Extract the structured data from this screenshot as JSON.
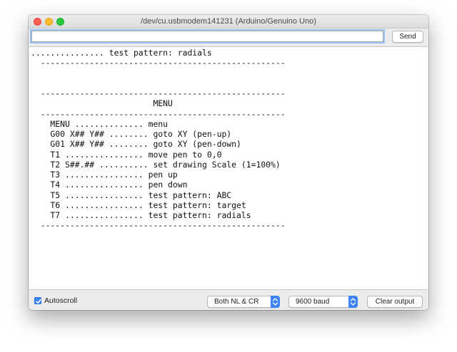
{
  "window": {
    "title": "/dev/cu.usbmodem141231 (Arduino/Genuino Uno)"
  },
  "toolbar": {
    "input_value": "",
    "send_label": "Send"
  },
  "output": {
    "lines": [
      "............... test pattern: radials",
      "  --------------------------------------------------",
      "",
      "",
      "  --------------------------------------------------",
      "                         MENU",
      "  --------------------------------------------------",
      "    MENU .............. menu",
      "    G00 X## Y## ........ goto XY (pen-up)",
      "    G01 X## Y## ........ goto XY (pen-down)",
      "    T1 ................ move pen to 0,0",
      "    T2 S##.## .......... set drawing Scale (1=100%)",
      "    T3 ................ pen up",
      "    T4 ................ pen down",
      "    T5 ................ test pattern: ABC",
      "    T6 ................ test pattern: target",
      "    T7 ................ test pattern: radials",
      "  --------------------------------------------------"
    ]
  },
  "statusbar": {
    "autoscroll_label": "Autoscroll",
    "autoscroll_checked": true,
    "line_ending": "Both NL & CR",
    "baud_rate": "9600 baud",
    "clear_label": "Clear output"
  },
  "colors": {
    "accent": "#3b83f7",
    "close": "#fd5f57",
    "minimize": "#febc2e",
    "maximize": "#28c840"
  },
  "icons": [
    "close-icon",
    "minimize-icon",
    "maximize-icon",
    "checkmark-icon",
    "stepper-arrows-icon"
  ]
}
